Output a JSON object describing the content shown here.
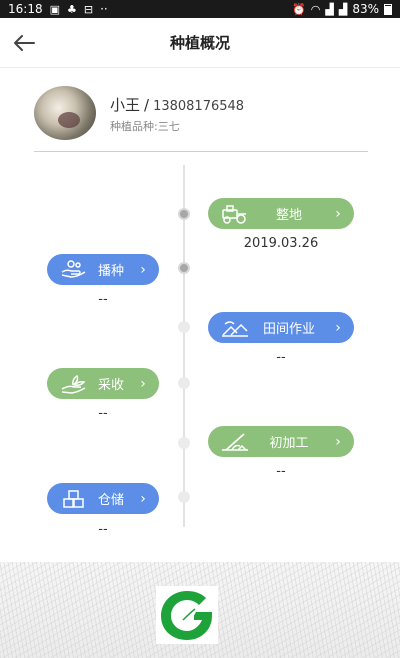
{
  "status_bar": {
    "time": "16:18",
    "left_icons": [
      "image-icon",
      "bag-icon",
      "wallet-icon"
    ],
    "dots": "··",
    "right_icons": [
      "alarm-icon",
      "wifi-icon",
      "signal-icon",
      "signal-icon"
    ],
    "battery_percent": "83%"
  },
  "header": {
    "title": "种植概况",
    "back_icon": "arrow-left-icon"
  },
  "profile": {
    "name": "小王",
    "separator": "/",
    "phone": "13808176548",
    "crop": "种植品种:三七"
  },
  "timeline": {
    "stages": [
      {
        "label": "整地",
        "date": "2019.03.26",
        "icon": "tractor-icon",
        "color": "#8dc07a",
        "side": "right",
        "active": true
      },
      {
        "label": "播种",
        "date": "--",
        "icon": "sowing-hand-icon",
        "color": "#5c8ee8",
        "side": "left",
        "active": true
      },
      {
        "label": "田间作业",
        "date": "--",
        "icon": "field-work-icon",
        "color": "#5c8ee8",
        "side": "right",
        "active": false
      },
      {
        "label": "采收",
        "date": "--",
        "icon": "harvest-icon",
        "color": "#8dc07a",
        "side": "left",
        "active": false
      },
      {
        "label": "初加工",
        "date": "--",
        "icon": "processing-icon",
        "color": "#8dc07a",
        "side": "right",
        "active": false
      },
      {
        "label": "仓储",
        "date": "--",
        "icon": "storage-boxes-icon",
        "color": "#5c8ee8",
        "side": "left",
        "active": false
      }
    ],
    "chevron": "›"
  },
  "footer": {
    "logo_icon": "brand-leaf-logo"
  }
}
